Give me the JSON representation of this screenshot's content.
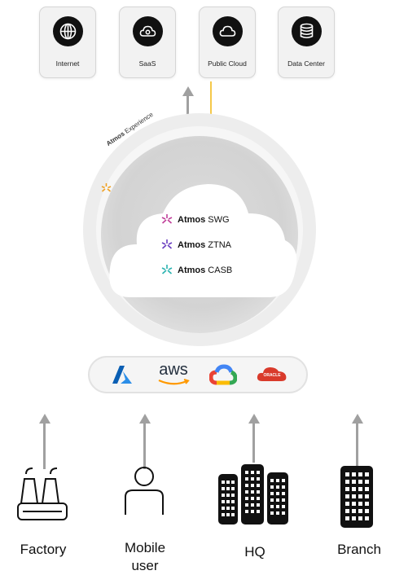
{
  "destinations": [
    {
      "label": "Internet",
      "icon": "globe-icon"
    },
    {
      "label": "SaaS",
      "icon": "cloud-gear-icon"
    },
    {
      "label": "Public Cloud",
      "icon": "cloud-icon"
    },
    {
      "label": "Data Center",
      "icon": "database-icon"
    }
  ],
  "ring_label": {
    "brand": "Atmos",
    "text": "Experience"
  },
  "services": [
    {
      "brand": "Atmos",
      "name": "SWG",
      "color": "#c0409a"
    },
    {
      "brand": "Atmos",
      "name": "ZTNA",
      "color": "#6a3fc0"
    },
    {
      "brand": "Atmos",
      "name": "CASB",
      "color": "#2ab3b0"
    }
  ],
  "providers": [
    {
      "name": "azure",
      "icon": "azure-logo-icon"
    },
    {
      "name": "aws",
      "icon": "aws-logo-icon"
    },
    {
      "name": "google cloud",
      "icon": "google-cloud-logo-icon"
    },
    {
      "name": "ORACLE",
      "icon": "oracle-logo-icon"
    }
  ],
  "sources": [
    {
      "label": "Factory",
      "icon": "factory-icon"
    },
    {
      "label": "Mobile\nuser",
      "icon": "user-icon"
    },
    {
      "label": "HQ",
      "icon": "buildings-icon"
    },
    {
      "label": "Branch",
      "icon": "building-icon"
    }
  ],
  "colors": {
    "accent_line": "#f5c84a",
    "arrow": "#a0a0a0",
    "ring": "#ececec",
    "cloud_shadow": "#d9d9d9"
  }
}
